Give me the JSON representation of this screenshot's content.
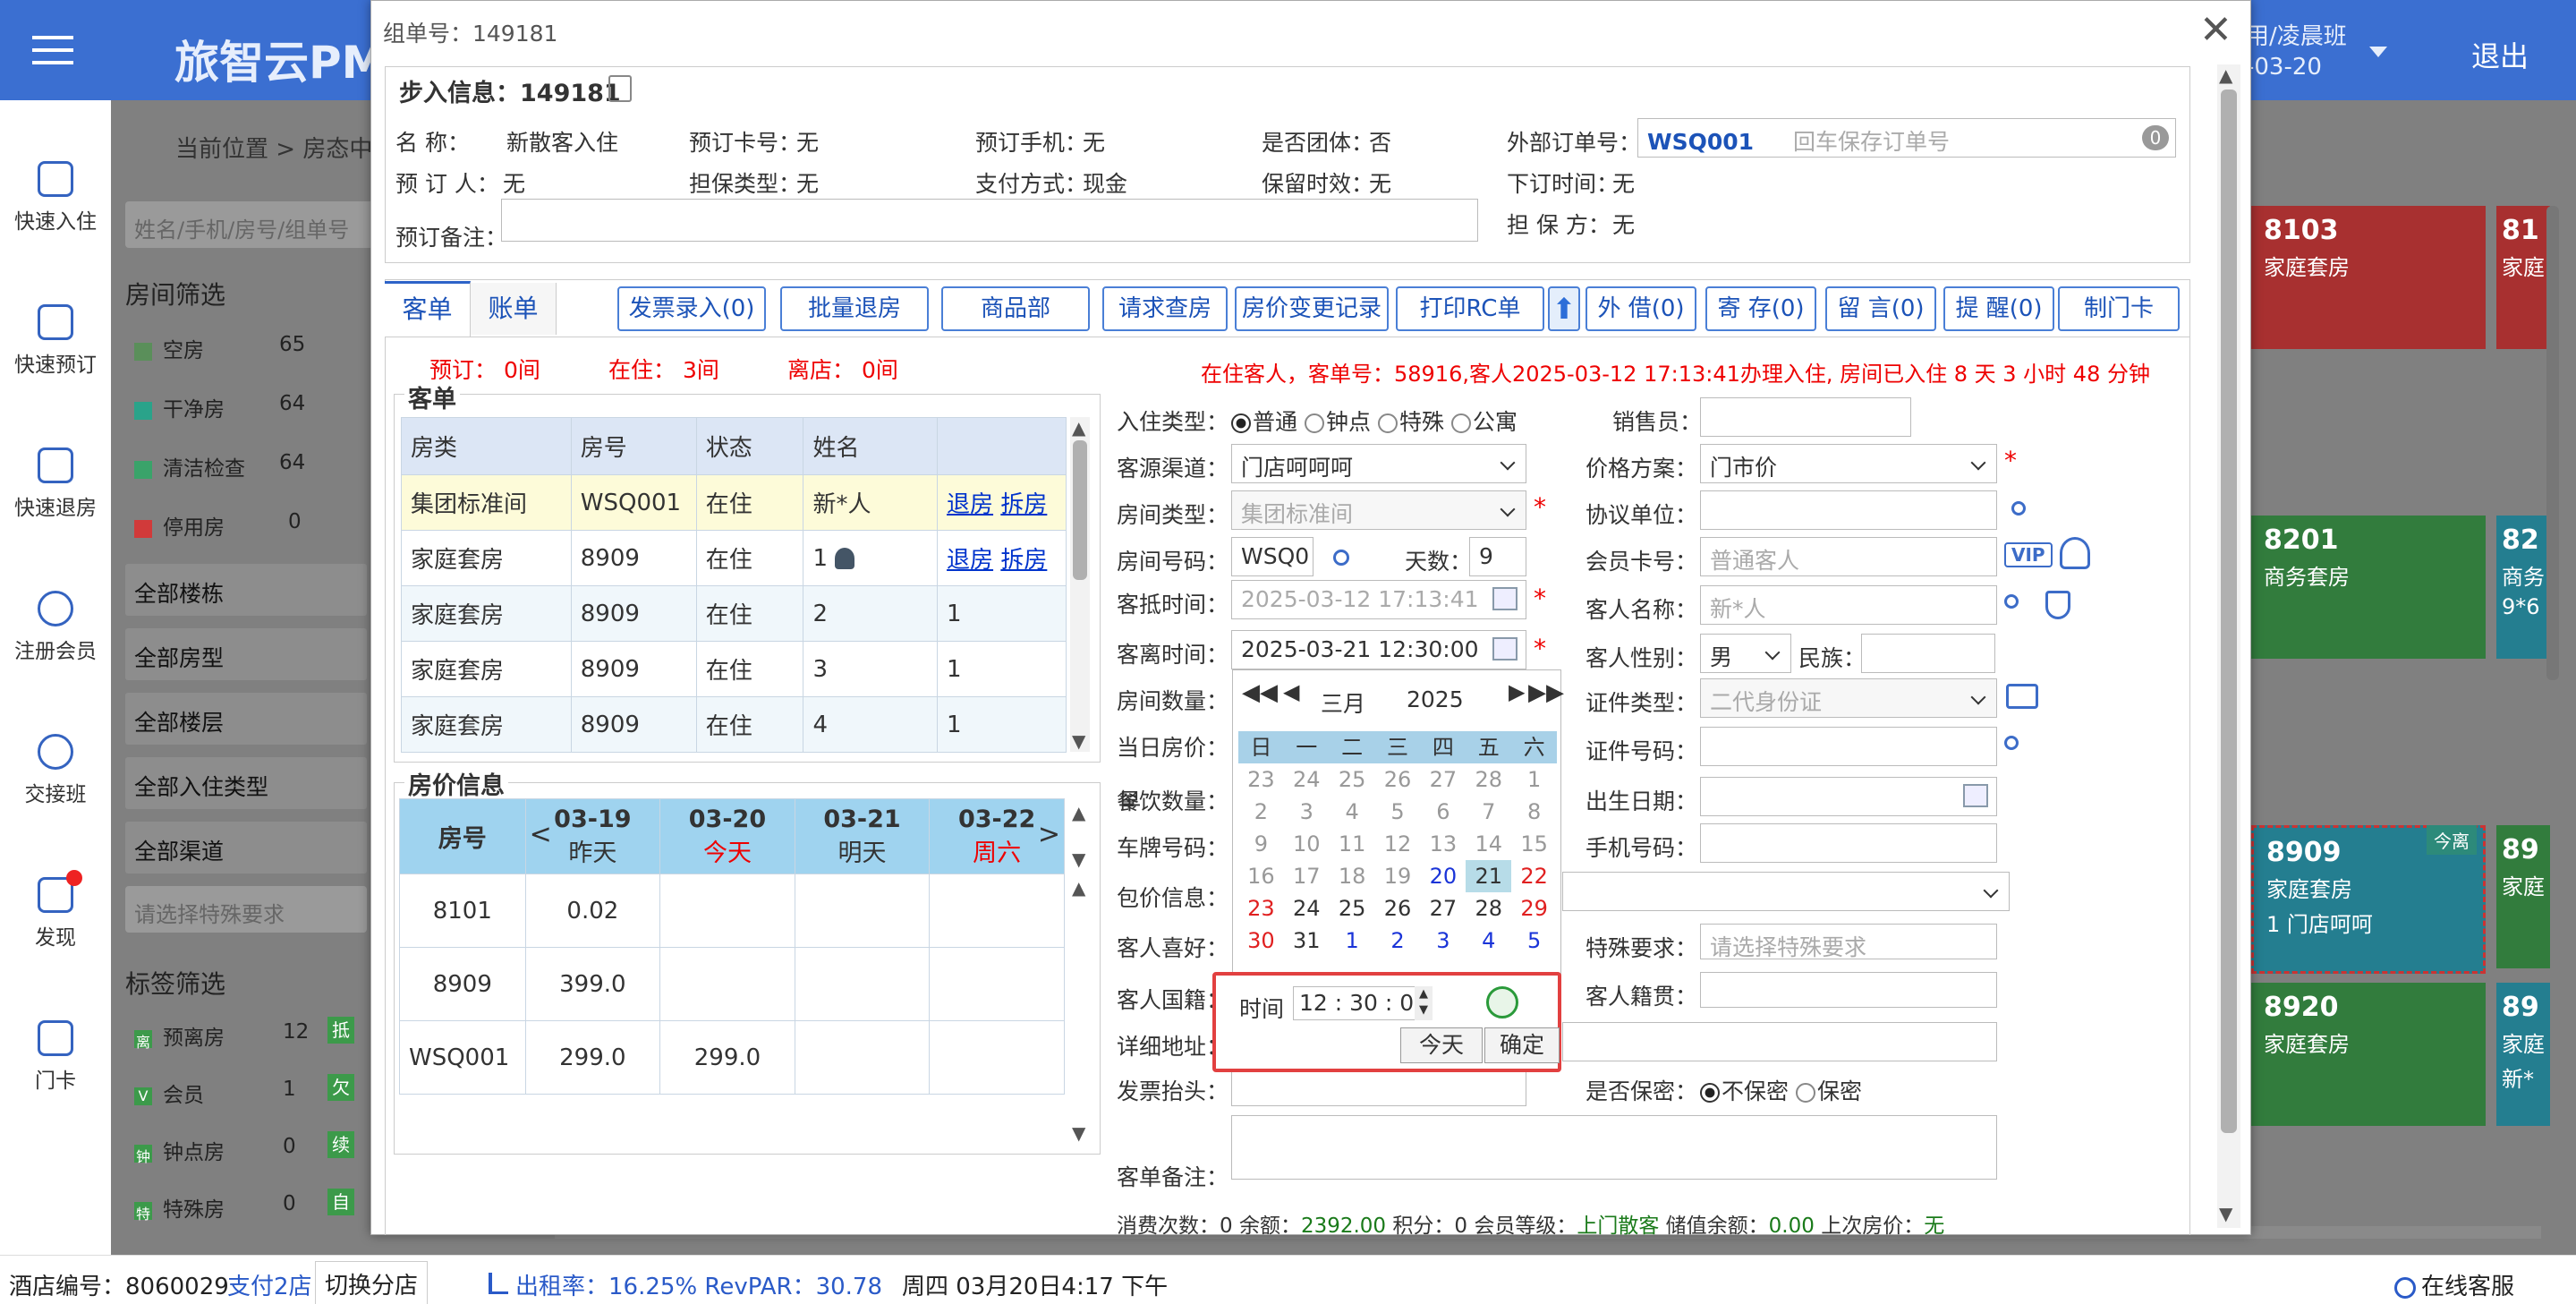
{
  "app": {
    "brand": "旅智云PM",
    "user": "用/凌晨班",
    "date_short": "-03-20",
    "logout": "退出"
  },
  "nav": [
    {
      "label": "快速入住",
      "icon": "home-enter-icon"
    },
    {
      "label": "快速预订",
      "icon": "booking-icon"
    },
    {
      "label": "快速退房",
      "icon": "checkout-icon"
    },
    {
      "label": "注册会员",
      "icon": "add-member-icon"
    },
    {
      "label": "交接班",
      "icon": "shift-icon"
    },
    {
      "label": "发现",
      "icon": "discover-icon"
    },
    {
      "label": "门卡",
      "icon": "door-card-icon"
    }
  ],
  "bg": {
    "breadcrumb": "当前位置  >  房态中",
    "search_placeholder": "姓名/手机/房号/组单号",
    "room_filter_title": "房间筛选",
    "status": [
      {
        "label": "空房",
        "count": "65",
        "color": "#5a8f5a"
      },
      {
        "label": "干净房",
        "count": "64",
        "color": "#2aa38a"
      },
      {
        "label": "清洁检查",
        "count": "64",
        "color": "#3aa36a"
      },
      {
        "label": "停用房",
        "count": "0",
        "color": "#d13a3a"
      }
    ],
    "filters": [
      "全部楼栋",
      "全部房型",
      "全部楼层",
      "全部入住类型",
      "全部渠道"
    ],
    "special_placeholder": "请选择特殊要求",
    "tag_filter_title": "标签筛选",
    "tags": [
      {
        "icon": "离",
        "label": "预离房",
        "count": "12"
      },
      {
        "icon": "V",
        "label": "会员",
        "count": "1"
      },
      {
        "icon": "钟",
        "label": "钟点房",
        "count": "0"
      },
      {
        "icon": "特",
        "label": "特殊房",
        "count": "0"
      }
    ],
    "tags_col2": [
      "抵",
      "欠",
      "续",
      "自"
    ],
    "tiles": [
      {
        "no": "8103",
        "type": "家庭套房",
        "color": "#c93a3a"
      },
      {
        "no": "81",
        "type": "家庭",
        "color": "#c93a3a"
      },
      {
        "no": "8201",
        "type": "商务套房",
        "color": "#3c9a4a"
      },
      {
        "no": "82",
        "type": "商务",
        "extra": "9*6",
        "color": "#2a9ab0"
      },
      {
        "no": "8909",
        "type": "家庭套房",
        "note": "1 门店呵呵",
        "badge": "今离",
        "color": "#2a9ab0"
      },
      {
        "no": "89",
        "type": "家庭",
        "color": "#3c9a4a"
      },
      {
        "no": "8920",
        "type": "家庭套房",
        "color": "#3c9a4a"
      },
      {
        "no": "89",
        "type": "家庭",
        "extra": "新*",
        "color": "#2a9ab0"
      }
    ]
  },
  "dialog": {
    "title": "组单号：149181",
    "section_title": "步入信息：149181",
    "info": {
      "name_label": "名      称：",
      "name": "新散客入住",
      "card_label": "预订卡号：",
      "card": "无",
      "phone_label": "预订手机：",
      "phone": "无",
      "group_label": "是否团体：",
      "group": "否",
      "ext_label": "外部订单号：",
      "ext": "WSQ001",
      "ext_placeholder": "回车保存订单号",
      "ext_count": "0",
      "booker_label": "预 订 人：",
      "booker": "无",
      "guar_label": "担保类型：",
      "guar": "无",
      "pay_label": "支付方式：",
      "pay": "现金",
      "keep_label": "保留时效：",
      "keep": "无",
      "ordertime_label": "下订时间：",
      "ordertime": "无",
      "remark_label": "预订备注：",
      "guarantor_label": "担 保 方：",
      "guarantor": "无"
    },
    "tabs": [
      "客单",
      "账单"
    ],
    "buttons": [
      "发票录入(0)",
      "批量退房",
      "商品部",
      "请求查房",
      "房价变更记录",
      "打印RC单",
      "外 借(0)",
      "寄 存(0)",
      "留 言(0)",
      "提 醒(0)",
      "制门卡"
    ],
    "counts": {
      "booked": "预订：  0间",
      "staying": "在住：  3间",
      "left": "离店：  0间"
    },
    "notice": "在住客人，客单号：58916,客人2025-03-12 17:13:41办理入住, 房间已入住 8 天 3 小时 48 分钟",
    "guests_title": "客单",
    "guest_headers": [
      "房类",
      "房号",
      "状态",
      "姓名",
      ""
    ],
    "guests": [
      {
        "type": "集团标准间",
        "room": "WSQ001",
        "status": "在住",
        "name": "新*人",
        "a1": "退房",
        "a2": "拆房"
      },
      {
        "type": "家庭套房",
        "room": "8909",
        "status": "在住",
        "name": "1",
        "a1": "退房",
        "a2": "拆房"
      },
      {
        "type": "家庭套房",
        "room": "8909",
        "status": "在住",
        "name": "2",
        "a1": "1",
        "a2": ""
      },
      {
        "type": "家庭套房",
        "room": "8909",
        "status": "在住",
        "name": "3",
        "a1": "1",
        "a2": ""
      },
      {
        "type": "家庭套房",
        "room": "8909",
        "status": "在住",
        "name": "4",
        "a1": "1",
        "a2": ""
      }
    ],
    "price_title": "房价信息",
    "price_headers": {
      "room": "房号",
      "days": [
        {
          "date": "03-19",
          "day": "昨天"
        },
        {
          "date": "03-20",
          "day": "今天"
        },
        {
          "date": "03-21",
          "day": "明天"
        },
        {
          "date": "03-22",
          "day": "周六"
        }
      ]
    },
    "prices": [
      {
        "room": "8101",
        "v1": "0.02",
        "v2": ""
      },
      {
        "room": "8909",
        "v1": "399.0",
        "v2": ""
      },
      {
        "room": "WSQ001",
        "v1": "299.0",
        "v2": "299.0"
      }
    ],
    "form": {
      "checkin_type_label": "入住类型：",
      "types": [
        "普通",
        "钟点",
        "特殊",
        "公寓"
      ],
      "source_label": "客源渠道：",
      "source": "门店呵呵呵",
      "roomtype_label": "房间类型：",
      "roomtype": "集团标准间",
      "roomno_label": "房间号码：",
      "roomno": "WSQ0",
      "days_label": "天数：",
      "days": "9",
      "arrive_label": "客抵时间：",
      "arrive": "2025-03-12 17:13:41",
      "depart_label": "客离时间：",
      "depart": "2025-03-21 12:30:00",
      "roomcount_label": "房间数量：",
      "dayprice_label": "当日房价：",
      "meal_label": "餐饮数量：",
      "meal_value": "早",
      "plate_label": "车牌号码：",
      "package_label": "包价信息：",
      "hobby_label": "客人喜好：",
      "nation_label": "客人国籍：",
      "address_label": "详细地址：",
      "invoice_label": "发票抬头：",
      "remark_label": "客单备注：",
      "sales_label": "销售员：",
      "plan_label": "价格方案：",
      "plan": "门市价",
      "agree_label": "协议单位：",
      "member_label": "会员卡号：",
      "member_placeholder": "普通客人",
      "vip": "VIP",
      "gname_label": "客人名称：",
      "gname_placeholder": "新*人",
      "gender_label": "客人性别：",
      "gender": "男",
      "ethnic_label": "民族：",
      "idtype_label": "证件类型：",
      "idtype": "二代身份证",
      "idno_label": "证件号码：",
      "birth_label": "出生日期：",
      "mobile_label": "手机号码：",
      "special_label": "特殊要求：",
      "special_placeholder": "请选择特殊要求",
      "origin_label": "客人籍贯：",
      "secret_label": "是否保密：",
      "secret_opts": [
        "不保密",
        "保密"
      ]
    },
    "footer": {
      "visits_label": "消费次数：",
      "visits": "0",
      "balance_label": "余额：",
      "balance": "2392.00",
      "points_label": "积分：",
      "points": "0",
      "level_label": "会员等级：",
      "level": "上门散客",
      "stored_label": "储值余额：",
      "stored": "0.00",
      "last_label": "上次房价：",
      "last": "无"
    }
  },
  "calendar": {
    "month": "三月",
    "year": "2025",
    "weekdays": [
      "日",
      "一",
      "二",
      "三",
      "四",
      "五",
      "六"
    ],
    "weeks": [
      [
        "23",
        "24",
        "25",
        "26",
        "27",
        "28",
        "1"
      ],
      [
        "2",
        "3",
        "4",
        "5",
        "6",
        "7",
        "8"
      ],
      [
        "9",
        "10",
        "11",
        "12",
        "13",
        "14",
        "15"
      ],
      [
        "16",
        "17",
        "18",
        "19",
        "20",
        "21",
        "22"
      ],
      [
        "23",
        "24",
        "25",
        "26",
        "27",
        "28",
        "29"
      ],
      [
        "30",
        "31",
        "1",
        "2",
        "3",
        "4",
        "5"
      ]
    ],
    "time_label": "时间",
    "hour": "12",
    "minute": "30",
    "second": "0",
    "today": "今天",
    "ok": "确定"
  },
  "status": {
    "hotel_label": "酒店编号：",
    "hotel": "8060029",
    "branches": "支付2店",
    "switch": "切换分店",
    "occupancy_label": "出租率：",
    "occupancy": "16.25%",
    "revpar_label": "RevPAR：",
    "revpar": "30.78",
    "datetime": "周四 03月20日4:17 下午",
    "service": "在线客服"
  }
}
